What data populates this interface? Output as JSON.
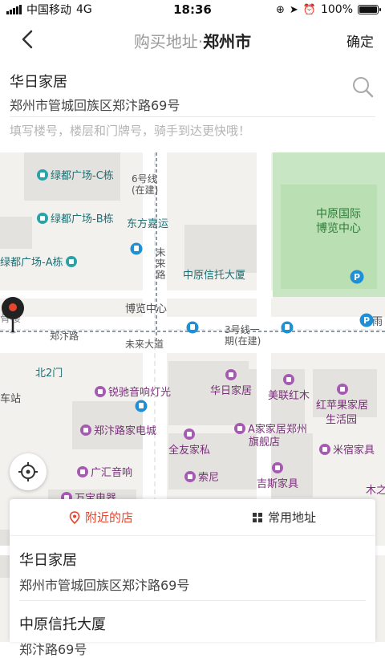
{
  "status_bar": {
    "carrier": "中国移动",
    "network": "4G",
    "time": "18:36",
    "battery": "100%"
  },
  "nav": {
    "title_prefix": "购买地址·",
    "title_city": "郑州市",
    "confirm_label": "确定"
  },
  "address": {
    "name": "华日家居",
    "detail": "郑州市管城回族区郑汴路69号",
    "hint": "填写楼号，楼层和门牌号，骑手到达更快哦！"
  },
  "map": {
    "labels": {
      "lvdu_c": "绿都广场-C栋",
      "lvdu_b": "绿都广场-B栋",
      "lvdu_a": "绿都广场-A栋",
      "dongfang": "东方嘉运",
      "line6": "6号线",
      "line6_status": "(在建)",
      "weilai_lu": "未来路",
      "zhongyuan_trust": "中原信托大厦",
      "bolan": "博览中心",
      "zhengbian_lu": "郑汴路",
      "weilai_dadao": "未来大道",
      "line3": "3号线一",
      "line3_status": "期(在建)",
      "bei2men": "北2门",
      "chezhan": "车站",
      "ruichi": "锐驰音响灯光",
      "huari": "华日家居",
      "meilian": "美联红木",
      "zhengbian_elec": "郑汴路家电城",
      "quanyou": "全友家私",
      "ajia": "A家家居郑州",
      "ajia2": "旗舰店",
      "hongpingguo": "红苹果家居",
      "hongpingguo2": "生活园",
      "misu": "米宿家具",
      "guanghui": "广汇音响",
      "suoni": "索尼",
      "jisi": "吉斯家具",
      "wanbao": "万宝电器",
      "expo1": "中原国际",
      "expo2": "博览中心",
      "yu": "雨",
      "mu": "木之",
      "ge": "骨楼"
    }
  },
  "sheet": {
    "tab_nearby": "附近的店",
    "tab_common": "常用地址",
    "items": [
      {
        "name": "华日家居",
        "detail": "郑州市管城回族区郑汴路69号"
      },
      {
        "name": "中原信托大厦",
        "detail": "郑汴路69号"
      }
    ]
  },
  "colors": {
    "accent": "#e6452f",
    "park": "#c9e6c4",
    "poi_purple": "#a65bb3",
    "metro_blue": "#1f8fd6"
  }
}
